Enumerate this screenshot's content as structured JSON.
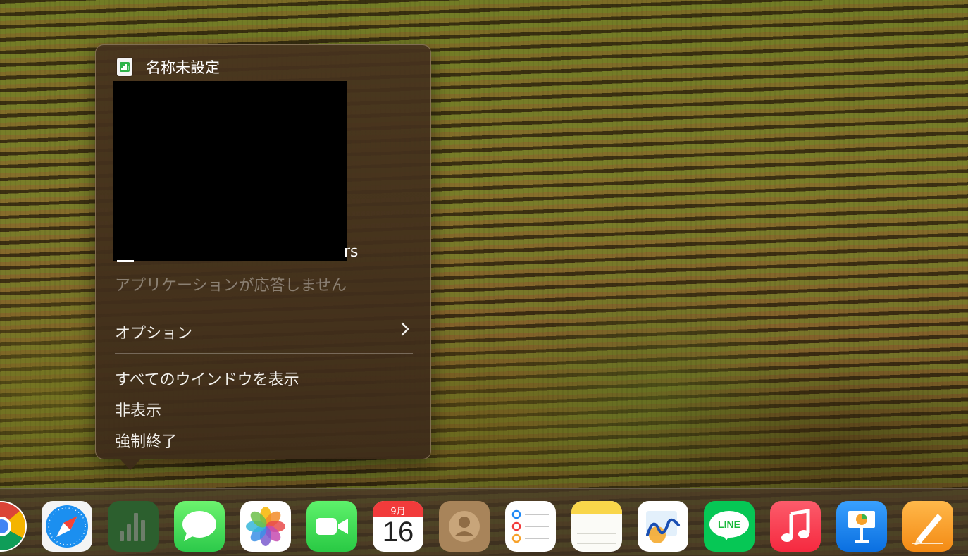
{
  "context_menu": {
    "document_title": "名称未設定",
    "preview_caption_fragment": "rs",
    "status_text": "アプリケーションが応答しません",
    "items": [
      {
        "label": "オプション"
      },
      {
        "label": "すべてのウインドウを表示"
      },
      {
        "label": "非表示"
      },
      {
        "label": "強制終了"
      }
    ]
  },
  "dock": {
    "apps": [
      {
        "name": "chrome-icon"
      },
      {
        "name": "safari-icon"
      },
      {
        "name": "numbers-icon"
      },
      {
        "name": "messages-icon"
      },
      {
        "name": "photos-icon"
      },
      {
        "name": "facetime-icon"
      },
      {
        "name": "calendar-icon"
      },
      {
        "name": "contacts-icon"
      },
      {
        "name": "reminders-icon"
      },
      {
        "name": "notes-icon"
      },
      {
        "name": "freeform-icon"
      },
      {
        "name": "line-icon"
      },
      {
        "name": "music-icon"
      },
      {
        "name": "keynote-icon"
      },
      {
        "name": "pages-icon"
      }
    ],
    "calendar": {
      "month": "9月",
      "day": "16"
    },
    "line_label": "LINE"
  },
  "colors": {
    "menu_background": "#3e2c1a",
    "numbers_green": "#1f7a2a",
    "messages_green": "#34c759",
    "music_red": "#fa3c4c",
    "keynote_blue": "#1e88f5",
    "pages_orange": "#f7a12a"
  }
}
